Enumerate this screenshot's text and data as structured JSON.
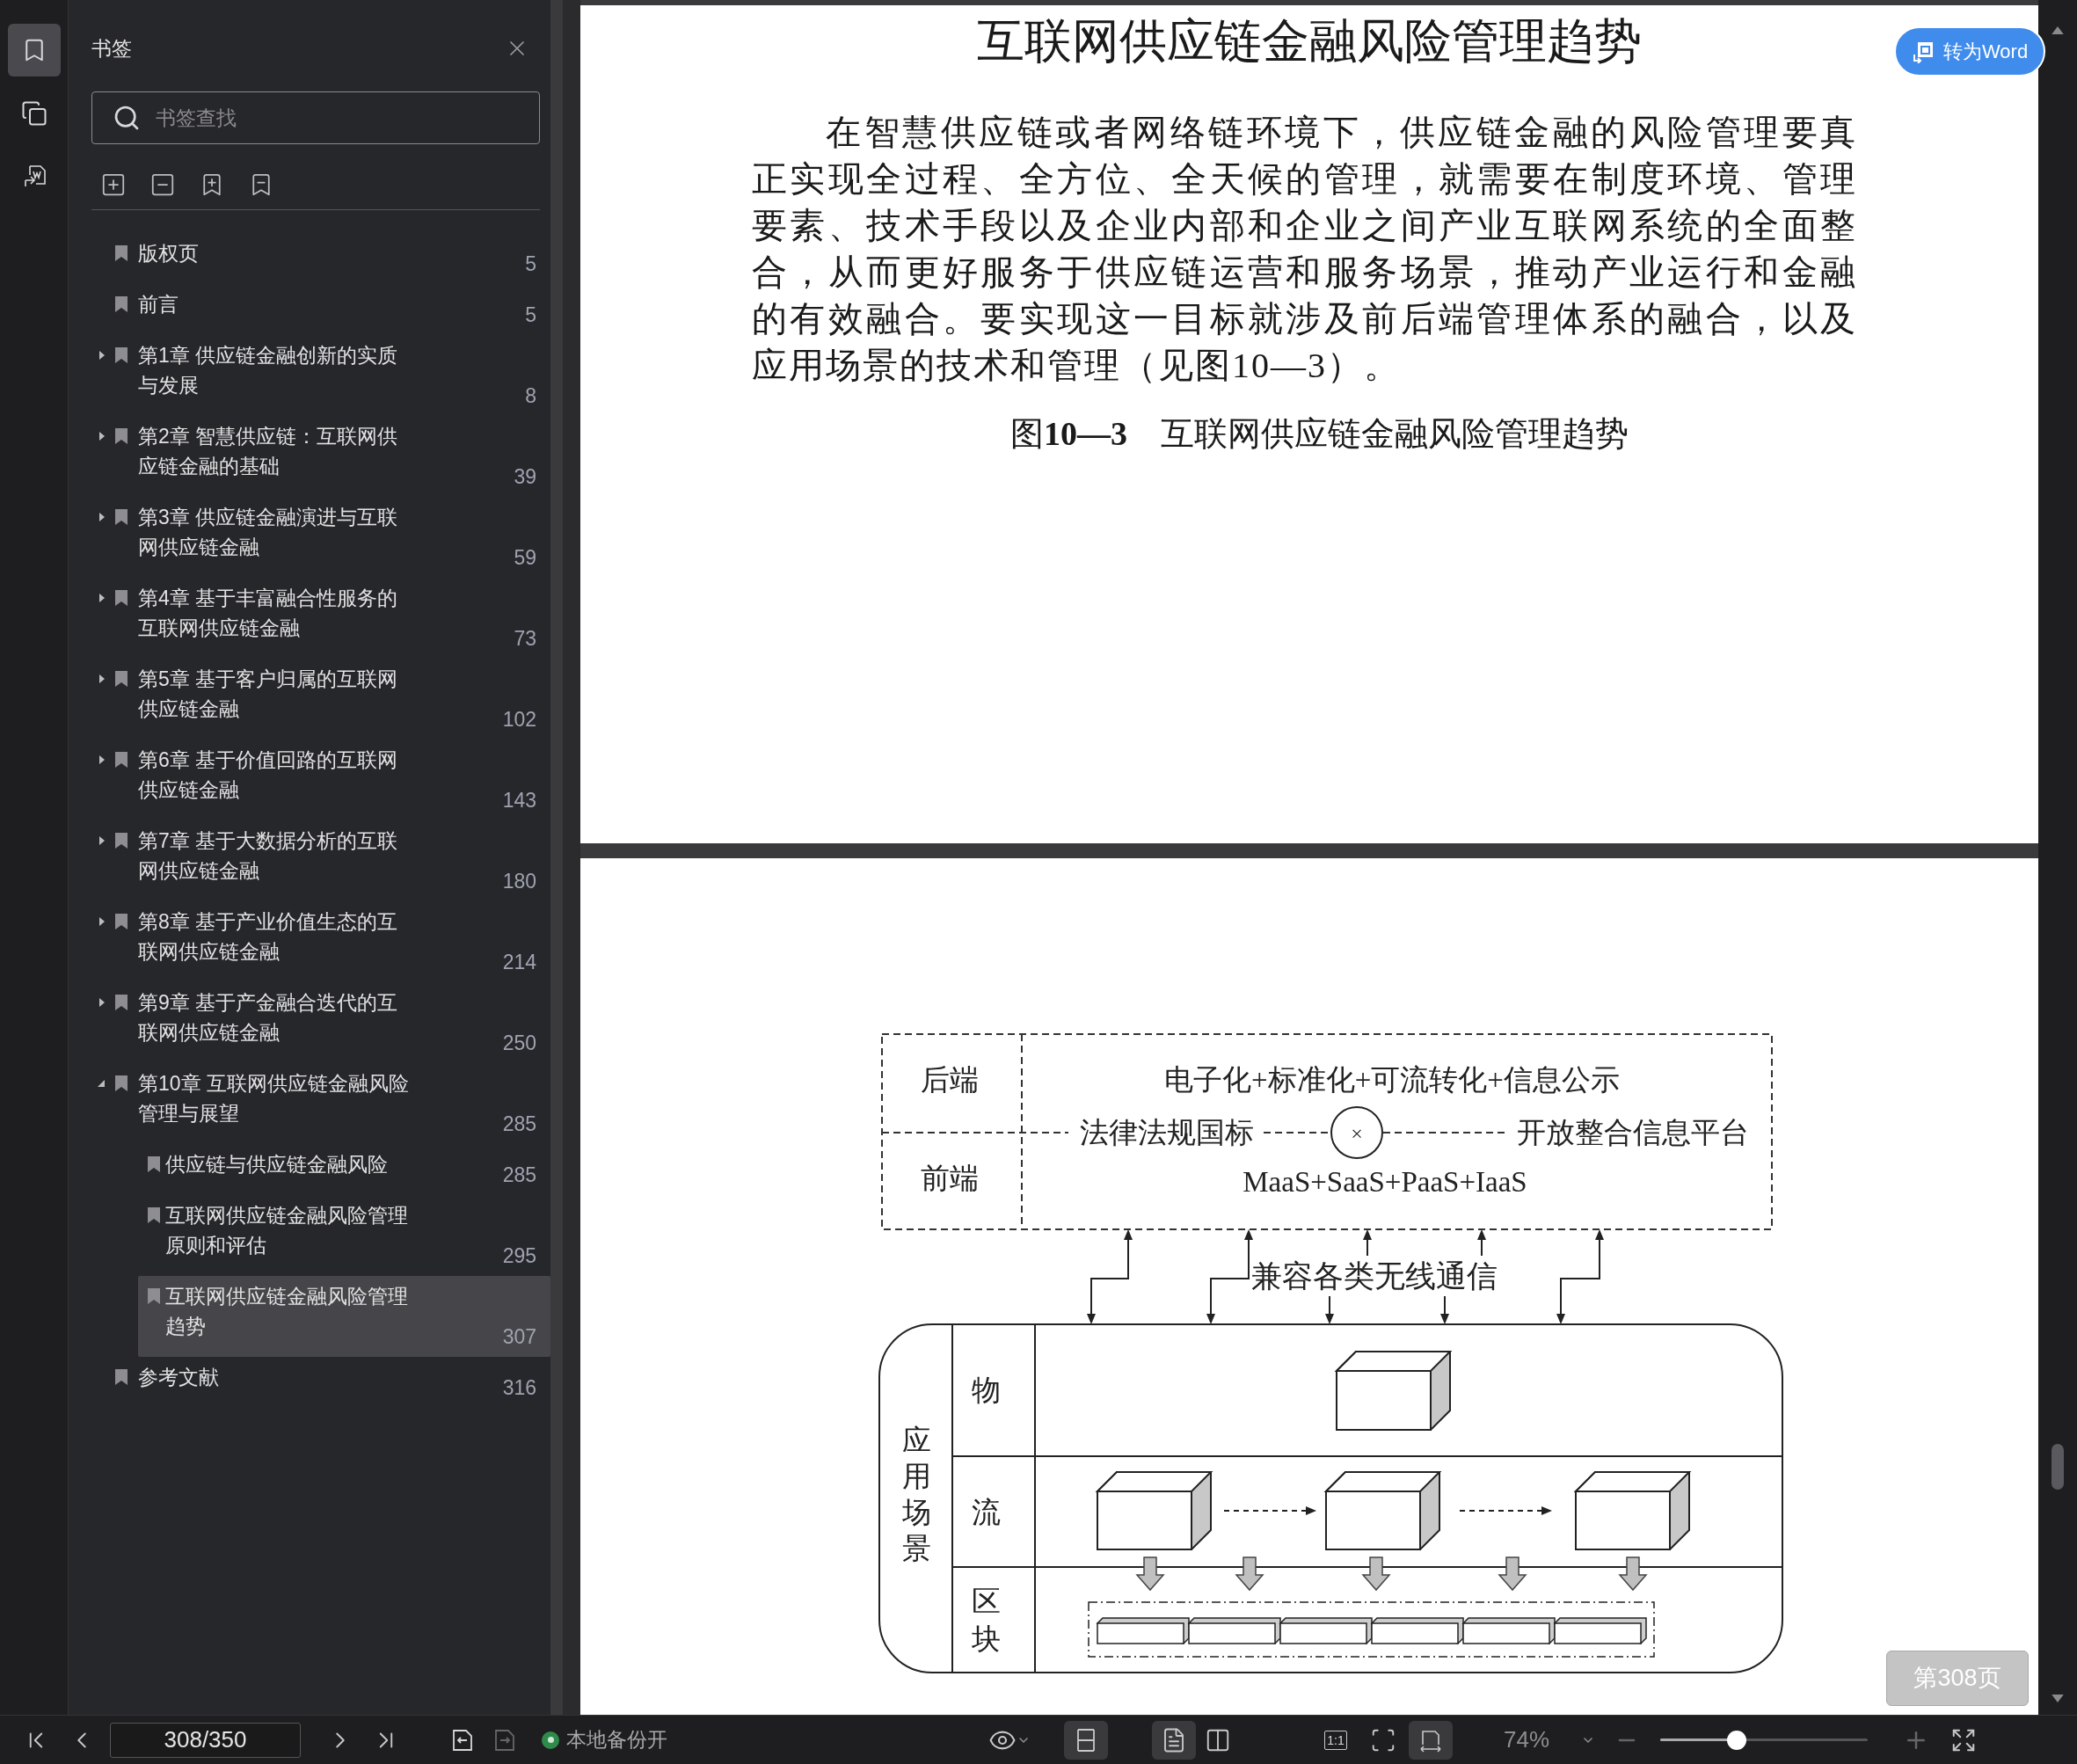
{
  "rail": [
    {
      "kind": "bookmarks",
      "selected": true
    },
    {
      "kind": "pages",
      "selected": false
    },
    {
      "kind": "convert",
      "selected": false
    }
  ],
  "sidebar": {
    "title": "书签",
    "search": {
      "placeholder": "书签查找"
    },
    "items": [
      {
        "title": "版权页",
        "page": "5",
        "selected": false
      },
      {
        "title": "前言",
        "page": "5",
        "selected": false
      },
      {
        "title": "第1章 供应链金融创新的实质与发展",
        "page": "8",
        "expanded": false,
        "selected": false
      },
      {
        "title": "第2章 智慧供应链：互联网供应链金融的基础",
        "page": "39",
        "expanded": false,
        "selected": false
      },
      {
        "title": "第3章 供应链金融演进与互联网供应链金融",
        "page": "59",
        "expanded": false,
        "selected": false
      },
      {
        "title": "第4章 基于丰富融合性服务的互联网供应链金融",
        "page": "73",
        "expanded": false,
        "selected": false
      },
      {
        "title": "第5章 基于客户归属的互联网供应链金融",
        "page": "102",
        "expanded": false,
        "selected": false
      },
      {
        "title": "第6章 基于价值回路的互联网供应链金融",
        "page": "143",
        "expanded": false,
        "selected": false
      },
      {
        "title": "第7章 基于大数据分析的互联网供应链金融",
        "page": "180",
        "expanded": false,
        "selected": false
      },
      {
        "title": "第8章 基于产业价值生态的互联网供应链金融",
        "page": "214",
        "expanded": false,
        "selected": false
      },
      {
        "title": "第9章 基于产金融合迭代的互联网供应链金融",
        "page": "250",
        "expanded": false,
        "selected": false
      },
      {
        "title": "第10章 互联网供应链金融风险管理与展望",
        "page": "285",
        "expanded": true,
        "selected": false,
        "children": [
          {
            "title": "供应链与供应链金融风险",
            "page": "285",
            "selected": false
          },
          {
            "title": "互联网供应链金融风险管理原则和评估",
            "page": "295",
            "selected": false
          },
          {
            "title": "互联网供应链金融风险管理趋势",
            "page": "307",
            "selected": true
          }
        ]
      },
      {
        "title": "参考文献",
        "page": "316",
        "selected": false
      }
    ]
  },
  "page_1": {
    "title": "互联网供应链金融风险管理趋势",
    "paragraph": "在智慧供应链或者网络链环境下，供应链金融的风险管理要真正实现全过程、全方位、全天候的管理，就需要在制度环境、管理要素、技术手段以及企业内部和企业之间产业互联网系统的全面整合，从而更好服务于供应链运营和服务场景，推动产业运行和金融的有效融合。要实现这一目标就涉及前后端管理体系的融合，以及应用场景的技术和管理（见图10—3）。",
    "caption": "图**10—3**　互联网供应链金融风险管理趋势"
  },
  "figure": {
    "back_label": "后端",
    "back_text": "电子化+标准化+可流转化+信息公示",
    "left_text": "法律法规国标",
    "operator": "×",
    "right_text": "开放整合信息平台",
    "front_label": "前端",
    "front_text": "MaaS+SaaS+PaaS+IaaS",
    "wireless_text": "兼容各类无线通信",
    "scene_label": "应用场景",
    "row_labels": [
      "物",
      "流",
      "区块"
    ]
  },
  "convert_button": "转为Word",
  "page_badge": "第308页",
  "toolbar": {
    "page_field": "308/350",
    "backup": {
      "label": "本地备份开",
      "on": true
    },
    "view_controls": [
      {
        "kind": "scroll",
        "selected": true
      },
      {
        "kind": "single",
        "selected": true
      },
      {
        "kind": "double",
        "selected": false
      },
      {
        "kind": "actual",
        "label": "1:1",
        "selected": false
      },
      {
        "kind": "fit_page",
        "selected": false
      },
      {
        "kind": "fit_width",
        "selected": true
      }
    ],
    "zoom": "74%",
    "zoom_slider": {
      "level": 0.37
    }
  }
}
